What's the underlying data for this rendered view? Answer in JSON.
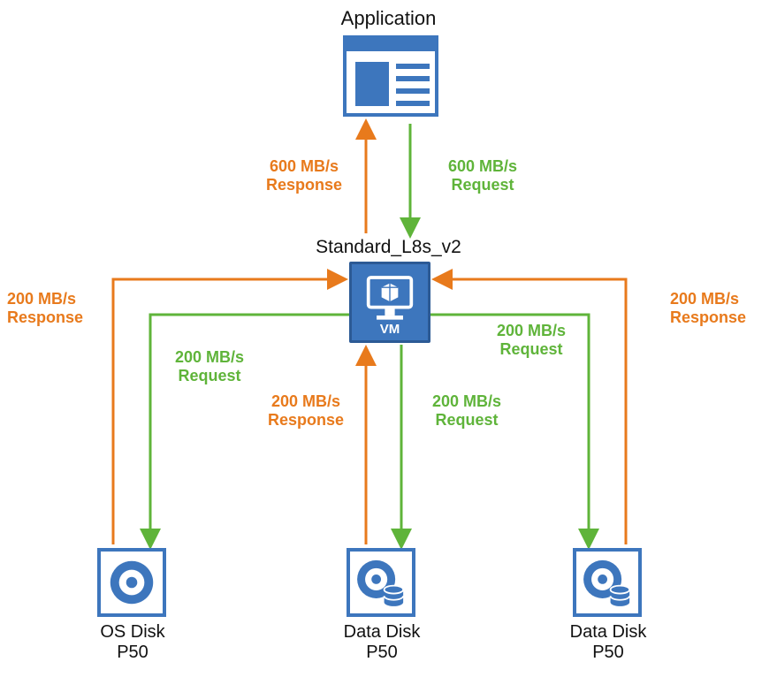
{
  "title": "Application",
  "nodes": {
    "application": {
      "label": "Application"
    },
    "vm": {
      "label": "Standard_L8s_v2",
      "caption": "VM"
    },
    "osdisk": {
      "label_line1": "OS Disk",
      "label_line2": "P50"
    },
    "datadisk_mid": {
      "label_line1": "Data Disk",
      "label_line2": "P50"
    },
    "datadisk_right": {
      "label_line1": "Data Disk",
      "label_line2": "P50"
    }
  },
  "flows": {
    "app_response": {
      "top": "600 MB/s",
      "bottom": "Response",
      "color": "orange"
    },
    "app_request": {
      "top": "600 MB/s",
      "bottom": "Request",
      "color": "green"
    },
    "vm_os_request": {
      "top": "200 MB/s",
      "bottom": "Request",
      "color": "green"
    },
    "os_vm_response": {
      "top": "200 MB/s",
      "bottom": "Response",
      "color": "orange"
    },
    "vm_mid_request": {
      "top": "200 MB/s",
      "bottom": "Request",
      "color": "green"
    },
    "mid_vm_response": {
      "top": "200 MB/s",
      "bottom": "Response",
      "color": "orange"
    },
    "vm_right_request": {
      "top": "200 MB/s",
      "bottom": "Request",
      "color": "green"
    },
    "right_vm_response": {
      "top": "200 MB/s",
      "bottom": "Response",
      "color": "orange"
    }
  },
  "colors": {
    "green": "#5fb43a",
    "orange": "#e87a1c",
    "brand": "#3d76bd"
  }
}
